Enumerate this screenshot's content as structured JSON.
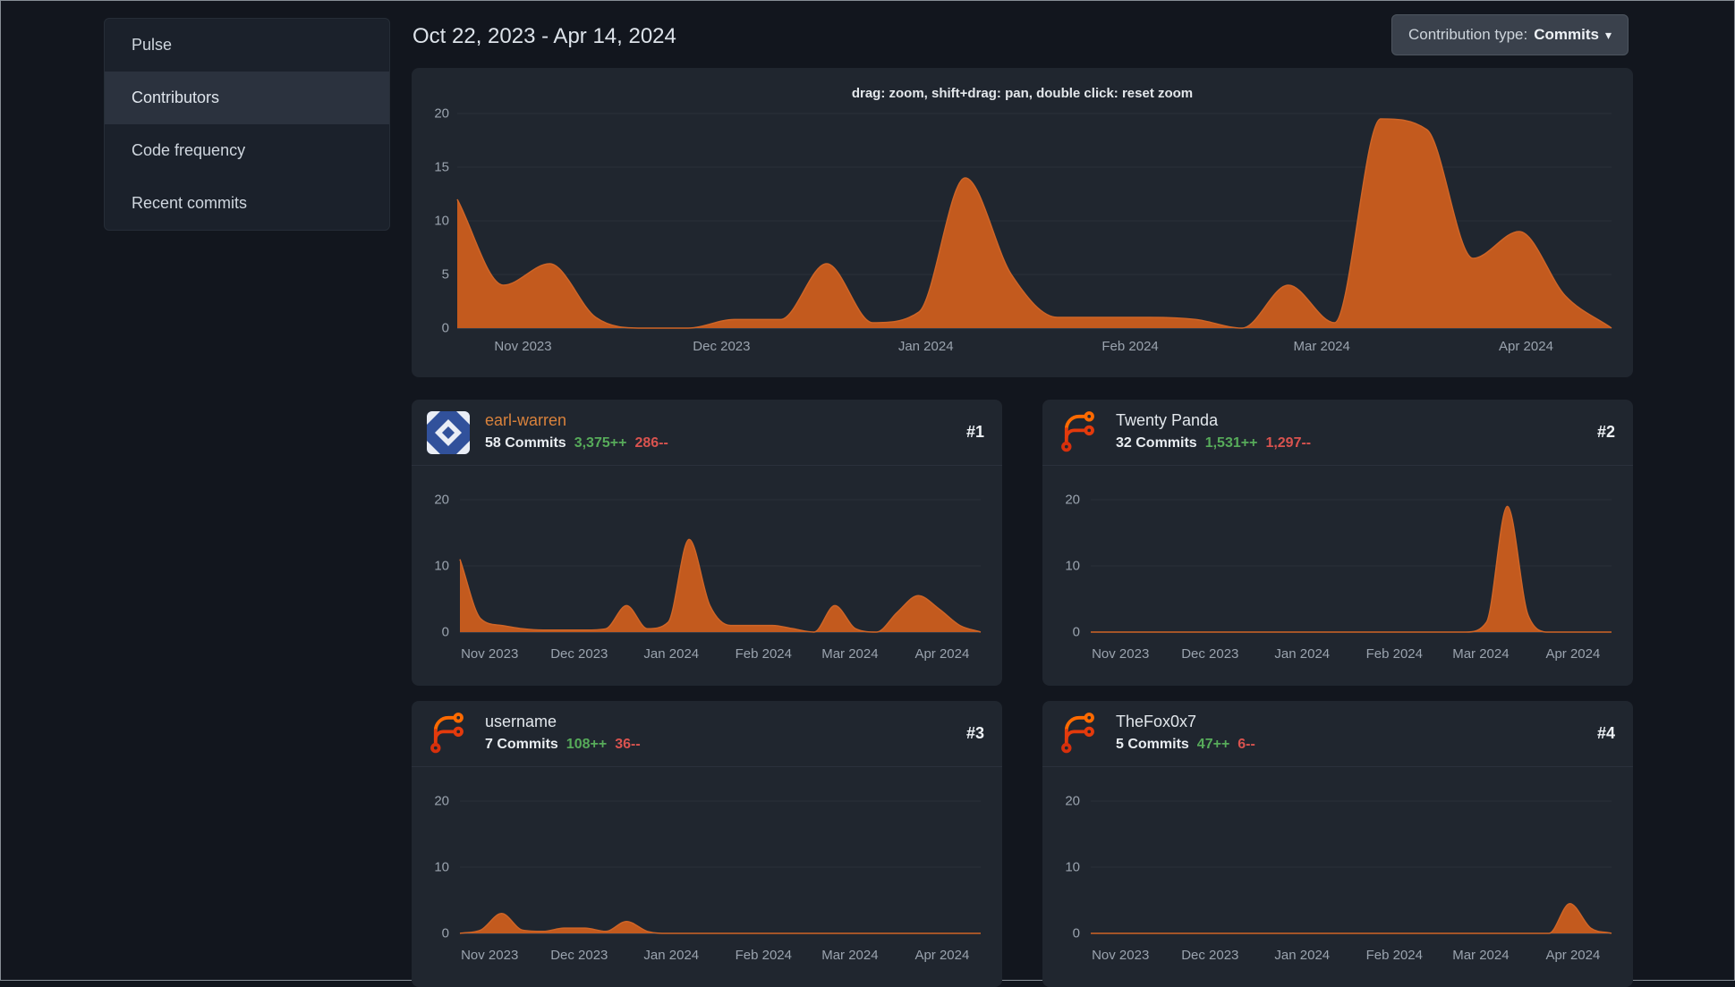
{
  "colors": {
    "page_bg": "#12161e",
    "card_bg": "#20262f",
    "accent_orange": "#c35a1e",
    "additions_green": "#57ab5a",
    "deletions_red": "#d9534f",
    "link_orange": "#d9823c"
  },
  "sidebar": {
    "items": [
      {
        "label": "Pulse",
        "active": false
      },
      {
        "label": "Contributors",
        "active": true
      },
      {
        "label": "Code frequency",
        "active": false
      },
      {
        "label": "Recent commits",
        "active": false
      }
    ]
  },
  "header": {
    "date_range": "Oct 22, 2023 - Apr 14, 2024"
  },
  "toolbar": {
    "contribution_type_label": "Contribution type:",
    "contribution_type_value": "Commits",
    "caret_icon": "▾"
  },
  "main_chart": {
    "hint": "drag: zoom, shift+drag: pan, double click: reset zoom"
  },
  "chart_data": [
    {
      "type": "area",
      "name": "overall-commits",
      "x_start": "Oct 22, 2023",
      "x_end": "Apr 14, 2024",
      "x_points": "weekly, 26 points",
      "values": [
        12,
        4,
        6,
        1,
        0,
        0,
        0.8,
        0.8,
        6,
        0.5,
        1.5,
        14,
        5,
        1,
        1,
        1,
        0.8,
        0,
        4,
        0.5,
        19.5,
        18.5,
        6.5,
        9,
        3,
        0
      ],
      "ylim": [
        0,
        20
      ],
      "y_ticks": [
        0,
        5,
        10,
        15,
        20
      ],
      "x_axis": {
        "tick_labels": [
          "Nov 2023",
          "Dec 2023",
          "Jan 2024",
          "Feb 2024",
          "Mar 2024",
          "Apr 2024"
        ],
        "tick_fractions": [
          0.057,
          0.229,
          0.406,
          0.583,
          0.749,
          0.926
        ]
      },
      "color": "#c35a1e",
      "line_color": "#cf6527",
      "grid": true,
      "legend": "none"
    },
    {
      "type": "area",
      "name": "earl-warren-commits",
      "x_start": "Oct 22, 2023",
      "x_end": "Apr 14, 2024",
      "x_points": "weekly, 26 points",
      "values": [
        11,
        2,
        1,
        0.5,
        0.3,
        0.3,
        0.3,
        0.5,
        4,
        0.5,
        1.5,
        14,
        4,
        1,
        1,
        1,
        0.5,
        0,
        4,
        0.5,
        0,
        3,
        5.5,
        3.5,
        1,
        0
      ],
      "ylim": [
        0,
        20
      ],
      "y_ticks": [
        0,
        10,
        20
      ],
      "x_axis": {
        "tick_labels": [
          "Nov 2023",
          "Dec 2023",
          "Jan 2024",
          "Feb 2024",
          "Mar 2024",
          "Apr 2024"
        ],
        "tick_fractions": [
          0.057,
          0.229,
          0.406,
          0.583,
          0.749,
          0.926
        ]
      },
      "color": "#c35a1e",
      "line_color": "#cf6527",
      "grid": true,
      "legend": "none"
    },
    {
      "type": "area",
      "name": "twenty-panda-commits",
      "x_start": "Oct 22, 2023",
      "x_end": "Apr 14, 2024",
      "x_points": "weekly, 26 points",
      "values": [
        0,
        0,
        0,
        0,
        0,
        0,
        0,
        0,
        0,
        0,
        0,
        0,
        0,
        0,
        0,
        0,
        0,
        0,
        0,
        1.5,
        19,
        2.5,
        0,
        0,
        0,
        0
      ],
      "ylim": [
        0,
        20
      ],
      "y_ticks": [
        0,
        10,
        20
      ],
      "x_axis": {
        "tick_labels": [
          "Nov 2023",
          "Dec 2023",
          "Jan 2024",
          "Feb 2024",
          "Mar 2024",
          "Apr 2024"
        ],
        "tick_fractions": [
          0.057,
          0.229,
          0.406,
          0.583,
          0.749,
          0.926
        ]
      },
      "color": "#c35a1e",
      "line_color": "#cf6527",
      "grid": true,
      "legend": "none"
    },
    {
      "type": "area",
      "name": "username-commits",
      "x_start": "Oct 22, 2023",
      "x_end": "Apr 14, 2024",
      "x_points": "weekly, 26 points",
      "values": [
        0,
        0.5,
        3,
        0.5,
        0.3,
        0.8,
        0.8,
        0.3,
        1.8,
        0.3,
        0,
        0,
        0,
        0,
        0,
        0,
        0,
        0,
        0,
        0,
        0,
        0,
        0,
        0,
        0,
        0
      ],
      "ylim": [
        0,
        20
      ],
      "y_ticks": [
        0,
        10,
        20
      ],
      "x_axis": {
        "tick_labels": [
          "Nov 2023",
          "Dec 2023",
          "Jan 2024",
          "Feb 2024",
          "Mar 2024",
          "Apr 2024"
        ],
        "tick_fractions": [
          0.057,
          0.229,
          0.406,
          0.583,
          0.749,
          0.926
        ]
      },
      "color": "#c35a1e",
      "line_color": "#cf6527",
      "grid": true,
      "legend": "none"
    },
    {
      "type": "area",
      "name": "thefox0x7-commits",
      "x_start": "Oct 22, 2023",
      "x_end": "Apr 14, 2024",
      "x_points": "weekly, 26 points",
      "values": [
        0,
        0,
        0,
        0,
        0,
        0,
        0,
        0,
        0,
        0,
        0,
        0,
        0,
        0,
        0,
        0,
        0,
        0,
        0,
        0,
        0,
        0,
        0,
        4.5,
        0.8,
        0
      ],
      "ylim": [
        0,
        20
      ],
      "y_ticks": [
        0,
        10,
        20
      ],
      "x_axis": {
        "tick_labels": [
          "Nov 2023",
          "Dec 2023",
          "Jan 2024",
          "Feb 2024",
          "Mar 2024",
          "Apr 2024"
        ],
        "tick_fractions": [
          0.057,
          0.229,
          0.406,
          0.583,
          0.749,
          0.926
        ]
      },
      "color": "#c35a1e",
      "line_color": "#cf6527",
      "grid": true,
      "legend": "none"
    }
  ],
  "contributors": [
    {
      "rank": "#1",
      "name": "earl-warren",
      "name_color": "#d9823c",
      "commits": "58 Commits",
      "additions": "3,375++",
      "deletions": "286--",
      "avatar": "blue-identicon"
    },
    {
      "rank": "#2",
      "name": "Twenty Panda",
      "name_color": "#e2e7ec",
      "commits": "32 Commits",
      "additions": "1,531++",
      "deletions": "1,297--",
      "avatar": "forgejo-logo"
    },
    {
      "rank": "#3",
      "name": "username",
      "name_color": "#e2e7ec",
      "commits": "7 Commits",
      "additions": "108++",
      "deletions": "36--",
      "avatar": "forgejo-logo"
    },
    {
      "rank": "#4",
      "name": "TheFox0x7",
      "name_color": "#e2e7ec",
      "commits": "5 Commits",
      "additions": "47++",
      "deletions": "6--",
      "avatar": "forgejo-logo"
    }
  ]
}
